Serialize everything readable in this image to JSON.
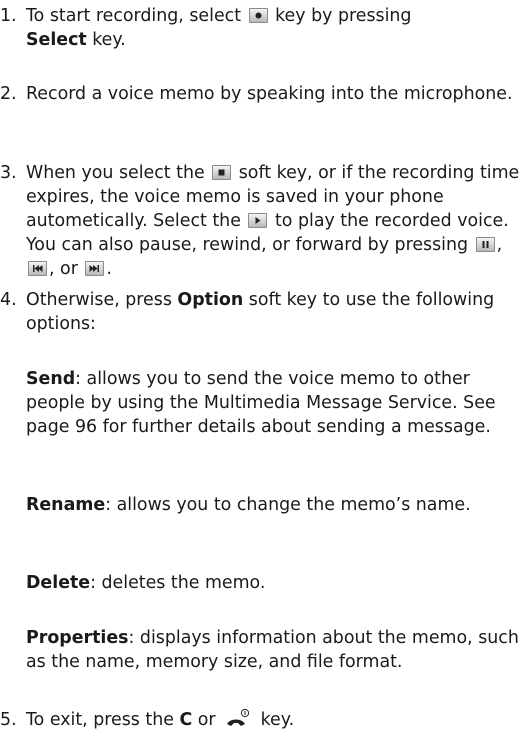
{
  "steps": [
    {
      "num": "1.",
      "a": "To start recording, select",
      "b": "key by pressing",
      "bold1": "Select",
      "c": "key."
    },
    {
      "num": "2.",
      "text": "Record a voice memo by speaking into the microphone."
    },
    {
      "num": "3.",
      "a": "When you select the",
      "b": "soft key, or if the recording time expires, the voice memo is saved in your phone autometically. Select the",
      "c": "to play the recorded voice. You can also pause, rewind, or forward by pressing",
      "comma1": ",",
      "or": ", or",
      "end": "."
    },
    {
      "num": "4.",
      "a": "Otherwise, press",
      "bold1": "Option",
      "b": "soft key to use the following options:"
    },
    {
      "num": "5.",
      "a": "To exit, press the",
      "bold1": "C",
      "b": "or",
      "c": "key."
    }
  ],
  "options": [
    {
      "label": "Send",
      "desc": ": allows you to send the voice memo to other people by using the Multimedia Message Service. See page 96 for further details about sending a message."
    },
    {
      "label": "Rename",
      "desc": ": allows you to change the memo’s name."
    },
    {
      "label": "Delete",
      "desc": ": deletes the memo."
    },
    {
      "label": "Properties",
      "desc": ": displays information about the memo, such as the name, memory size, and file format."
    }
  ],
  "icons": [
    "record-icon",
    "stop-icon",
    "play-icon",
    "pause-icon",
    "rewind-icon",
    "forward-icon",
    "power-end-key-icon"
  ]
}
